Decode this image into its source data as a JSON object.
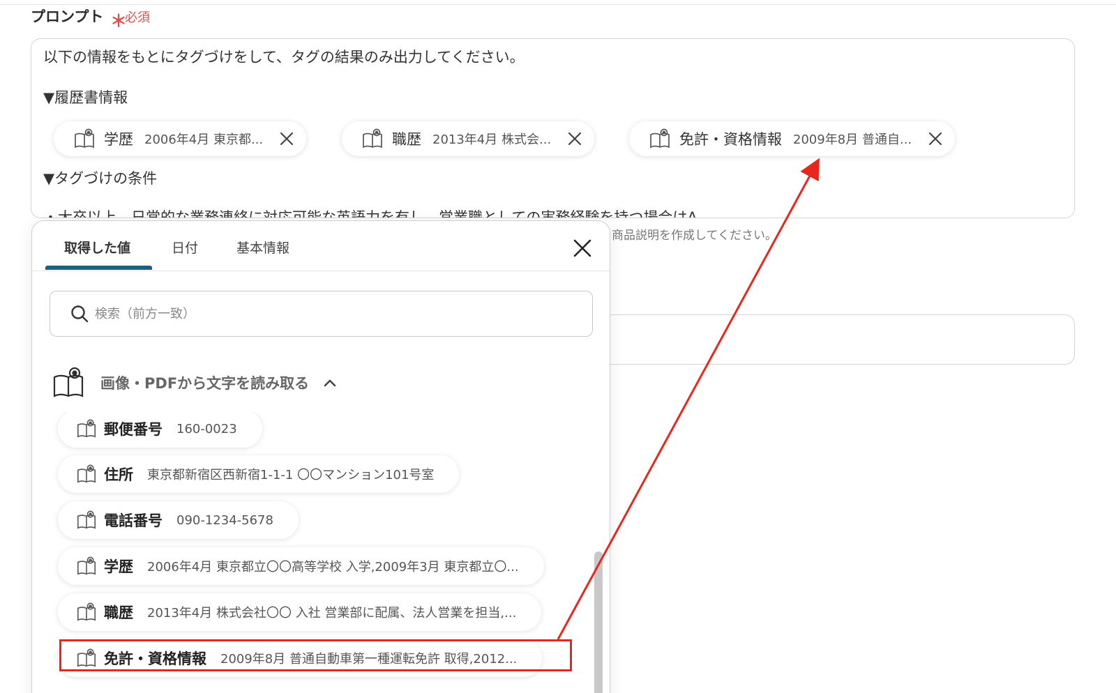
{
  "field": {
    "label": "プロンプト",
    "required_star": "＊",
    "required_text": "必須"
  },
  "prompt": {
    "lines": [
      "以下の情報をもとにタグづけをして、タグの結果のみ出力してください。",
      "▼履歴書情報",
      "▼タグづけの条件",
      "・大卒以上、日常的な業務連絡に対応可能な英語力を有し、営業職としての実務経験を持つ場合はA"
    ],
    "chips": [
      {
        "name": "学歴",
        "value": "2006年4月 東京都..."
      },
      {
        "name": "職歴",
        "value": "2013年4月 株式会..."
      },
      {
        "name": "免許・資格情報",
        "value": "2009年8月 普通自..."
      }
    ]
  },
  "hint_text": "商品説明を作成してください。",
  "popover": {
    "tabs": [
      "取得した値",
      "日付",
      "基本情報"
    ],
    "active_tab": "取得した値",
    "search_placeholder": "検索（前方一致）",
    "group_label": "画像・PDFから文字を読み取る",
    "items": [
      {
        "name": "郵便番号",
        "value": "160-0023"
      },
      {
        "name": "住所",
        "value": "東京都新宿区西新宿1-1-1 〇〇マンション101号室"
      },
      {
        "name": "電話番号",
        "value": "090-1234-5678"
      },
      {
        "name": "学歴",
        "value": "2006年4月 東京都立〇〇高等学校 入学,2009年3月 東京都立〇..."
      },
      {
        "name": "職歴",
        "value": "2013年4月 株式会社〇〇 入社 営業部に配属、法人営業を担当,..."
      },
      {
        "name": "免許・資格情報",
        "value": "2009年8月 普通自動車第一種運転免許 取得,2012..."
      }
    ]
  },
  "colors": {
    "accent": "#1d5f7d",
    "required": "#e54b4b",
    "annotation": "#e8261c"
  },
  "icons": {
    "chip_icon": "book-eye-icon",
    "remove_icon": "close-icon",
    "search_icon": "search-icon",
    "collapse_icon": "chevron-up-icon"
  }
}
